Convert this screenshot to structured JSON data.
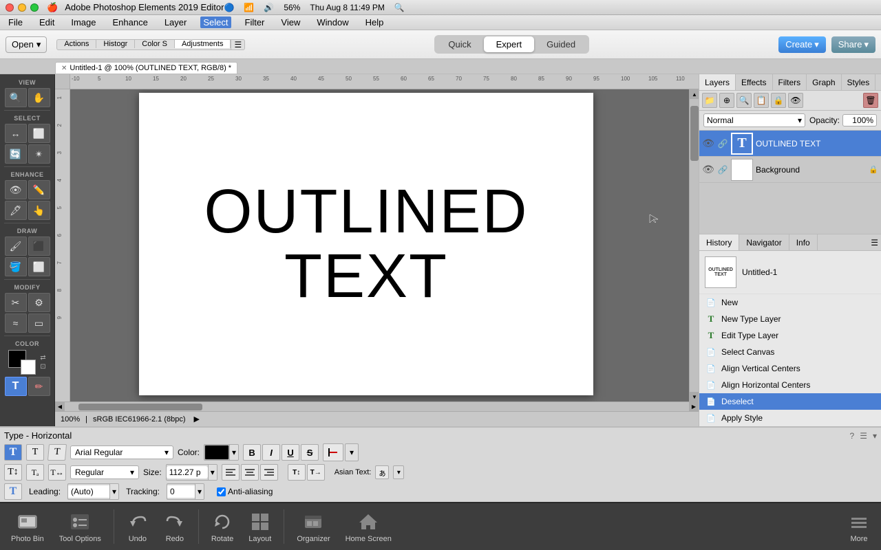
{
  "titlebar": {
    "app_name": "Adobe Photoshop Elements 2019 Editor",
    "close_label": "×",
    "min_label": "−",
    "max_label": "+",
    "system_icons": "🍎",
    "right_info": "Thu Aug 8  11:49 PM"
  },
  "menubar": {
    "items": [
      "File",
      "Edit",
      "Image",
      "Enhance",
      "Layer",
      "Select",
      "Filter",
      "View",
      "Window",
      "Help"
    ]
  },
  "toolbar": {
    "open_label": "Open",
    "tabs": [
      "Quick",
      "Guided",
      "Expert"
    ],
    "active_tab": "Expert",
    "create_label": "Create",
    "share_label": "Share"
  },
  "panel_tabs": {
    "items": [
      "Actions",
      "Histogr",
      "Color S",
      "Adjustments"
    ]
  },
  "doc_tab": {
    "label": "Untitled-1 @ 100% (OUTLINED TEXT, RGB/8) *"
  },
  "view_label": "VIEW",
  "select_label": "SELECT",
  "enhance_label": "ENHANCE",
  "draw_label": "DRAW",
  "modify_label": "MODIFY",
  "color_label": "COLOR",
  "canvas": {
    "text_line1": "OUTLINED",
    "text_line2": "TEXT"
  },
  "status": {
    "zoom": "100%",
    "color": "sRGB IEC61966-2.1 (8bpc)"
  },
  "layers_panel": {
    "header_tabs": [
      "Layers",
      "Effects",
      "Filters",
      "Graph",
      "Styles"
    ],
    "blend_mode": "Normal",
    "opacity_label": "Opacity:",
    "opacity_value": "100%",
    "layers": [
      {
        "name": "OUTLINED TEXT",
        "type": "text",
        "selected": true
      },
      {
        "name": "Background",
        "type": "bg",
        "selected": false
      }
    ]
  },
  "history_panel": {
    "tabs": [
      "History",
      "Navigator",
      "Info"
    ],
    "snapshot_label": "Untitled-1",
    "items": [
      {
        "label": "New",
        "icon": "📄"
      },
      {
        "label": "New Type Layer",
        "icon": "T"
      },
      {
        "label": "Edit Type Layer",
        "icon": "T"
      },
      {
        "label": "Select Canvas",
        "icon": "📄"
      },
      {
        "label": "Align Vertical Centers",
        "icon": "📄"
      },
      {
        "label": "Align Horizontal Centers",
        "icon": "📄"
      },
      {
        "label": "Deselect",
        "icon": "📄",
        "selected": true
      },
      {
        "label": "Apply Style",
        "icon": "📄"
      }
    ]
  },
  "type_toolbar": {
    "title": "Type - Horizontal",
    "font_name": "Arial Regular",
    "font_style": "Regular",
    "size_label": "Size:",
    "size_value": "112.27 p",
    "leading_label": "Leading:",
    "leading_value": "(Auto)",
    "tracking_label": "Tracking:",
    "tracking_value": "0",
    "color_label": "Color:",
    "asian_text_label": "Asian Text:",
    "anti_aliasing_label": "Anti-aliasing",
    "format_buttons": [
      "B",
      "I",
      "U",
      "S"
    ],
    "align_buttons": [
      "left",
      "center",
      "right"
    ]
  },
  "bottom_bar": {
    "buttons": [
      {
        "label": "Photo Bin",
        "icon": "🖼"
      },
      {
        "label": "Tool Options",
        "icon": "🔧"
      },
      {
        "label": "Undo",
        "icon": "↩"
      },
      {
        "label": "Redo",
        "icon": "↪"
      },
      {
        "label": "Rotate",
        "icon": "🔄"
      },
      {
        "label": "Layout",
        "icon": "⊞"
      },
      {
        "label": "Organizer",
        "icon": "📁"
      },
      {
        "label": "Home Screen",
        "icon": "🏠"
      },
      {
        "label": "More",
        "icon": "≫"
      }
    ]
  }
}
